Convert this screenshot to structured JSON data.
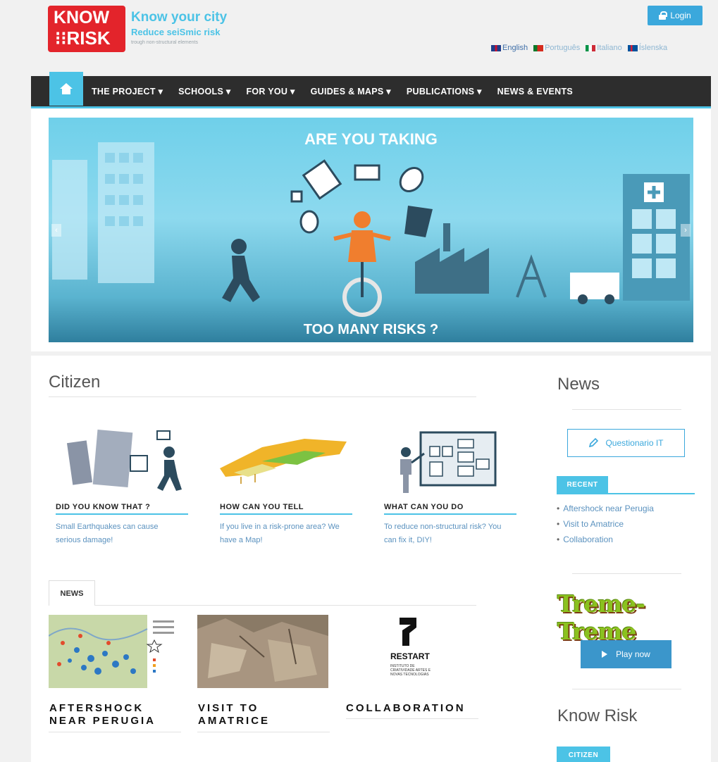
{
  "header": {
    "logo_line1": "KNOW",
    "logo_line2": "⁝⁝RISK",
    "tagline_1": "Know your city",
    "tagline_2": "Reduce seiSmic risk",
    "tagline_3": "trough non-structural elements",
    "login_label": "Login",
    "languages": [
      {
        "label": "English",
        "flag": "en"
      },
      {
        "label": "Português",
        "flag": "pt"
      },
      {
        "label": "Italiano",
        "flag": "it"
      },
      {
        "label": "Íslenska",
        "flag": "is"
      }
    ]
  },
  "nav": {
    "home_icon": "home-icon",
    "items": [
      "THE PROJECT ▾",
      "SCHOOLS ▾",
      "FOR YOU ▾",
      "GUIDES & MAPS ▾",
      "PUBLICATIONS ▾",
      "NEWS & EVENTS"
    ]
  },
  "hero": {
    "top_text": "ARE YOU TAKING",
    "bottom_text": "TOO MANY RISKS ?",
    "prev": "‹",
    "next": "›"
  },
  "citizen": {
    "title": "Citizen",
    "cards": [
      {
        "title": "DID YOU KNOW THAT ?",
        "desc_1": "Small Earthquakes can cause",
        "desc_2": "serious damage!"
      },
      {
        "title": "HOW CAN YOU TELL",
        "desc_1": "If you live in a risk-prone area? We",
        "desc_2": "have a Map!"
      },
      {
        "title": "WHAT CAN YOU DO",
        "desc_1": "To reduce non-structural risk? You",
        "desc_2": "can fix it, DIY!"
      }
    ]
  },
  "news_section": {
    "tab_label": "NEWS",
    "posts": [
      {
        "title_1": "AFTERSHOCK",
        "title_2": "NEAR PERUGIA"
      },
      {
        "title_1": "VISIT TO",
        "title_2": "AMATRICE"
      },
      {
        "title_1": "COLLABORATION",
        "title_2": ""
      }
    ],
    "restart_label": "RESTART",
    "restart_sub": "INSTITUTO DE CRIATIVIDADE ARTES E NOVAS TECNOLOGIAS"
  },
  "sidebar": {
    "news_title": "News",
    "questionario_label": "Questionario IT",
    "recent_tab": "RECENT",
    "recent_items": [
      "Aftershock near Perugia",
      "Visit to Amatrice",
      "Collaboration"
    ],
    "treme_label": "Treme-Treme",
    "play_label": "Play now",
    "know_risk_title": "Know Risk",
    "citizen_tab": "CITIZEN"
  },
  "colors": {
    "accent": "#4cc3e6",
    "brand_red": "#e3242b",
    "nav_bg": "#2d2d2d",
    "link": "#5b92bf"
  }
}
